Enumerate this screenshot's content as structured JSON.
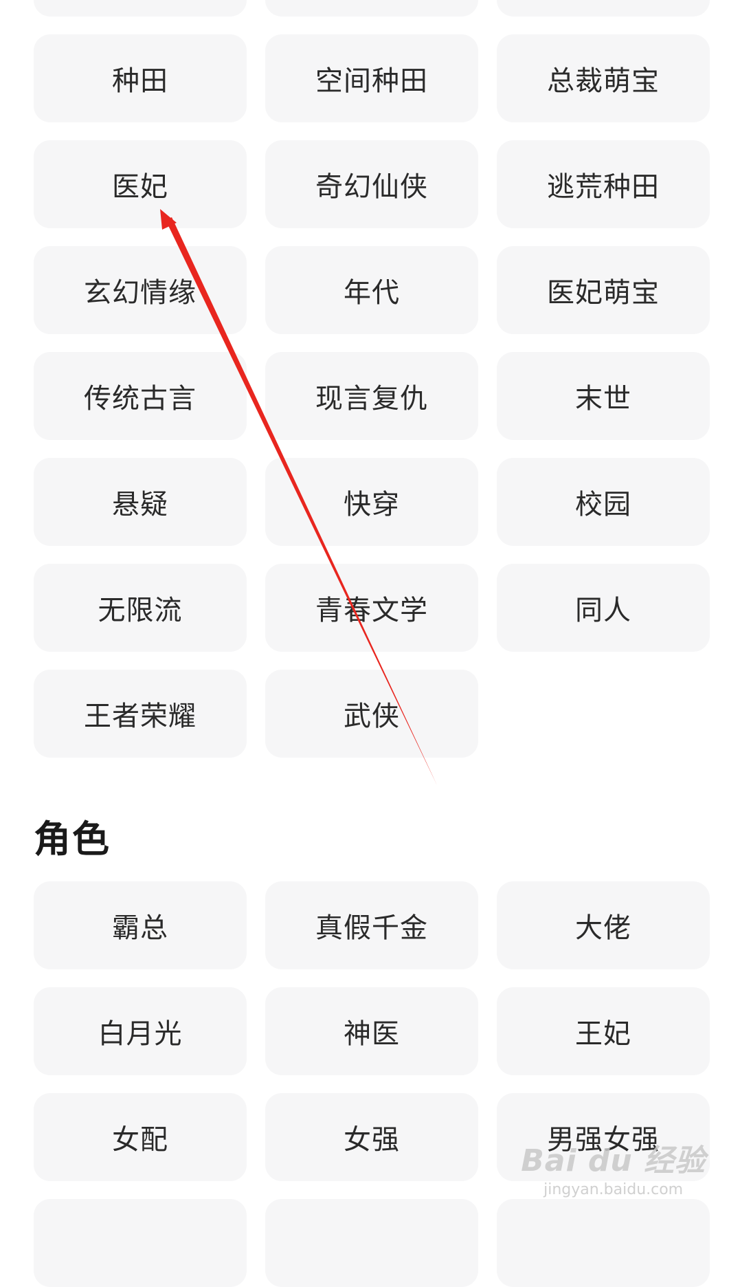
{
  "genre_tags": [
    "",
    "",
    "",
    "种田",
    "空间种田",
    "总裁萌宝",
    "医妃",
    "奇幻仙侠",
    "逃荒种田",
    "玄幻情缘",
    "年代",
    "医妃萌宝",
    "传统古言",
    "现言复仇",
    "末世",
    "悬疑",
    "快穿",
    "校园",
    "无限流",
    "青春文学",
    "同人",
    "王者荣耀",
    "武侠"
  ],
  "role_section": {
    "title": "角色",
    "tags": [
      "霸总",
      "真假千金",
      "大佬",
      "白月光",
      "神医",
      "王妃",
      "女配",
      "女强",
      "男强女强",
      "",
      "",
      ""
    ]
  },
  "annotation": {
    "arrow_color": "#e8261f"
  },
  "watermark": {
    "logo": "Bai du 经验",
    "sub": "jingyan.baidu.com"
  }
}
